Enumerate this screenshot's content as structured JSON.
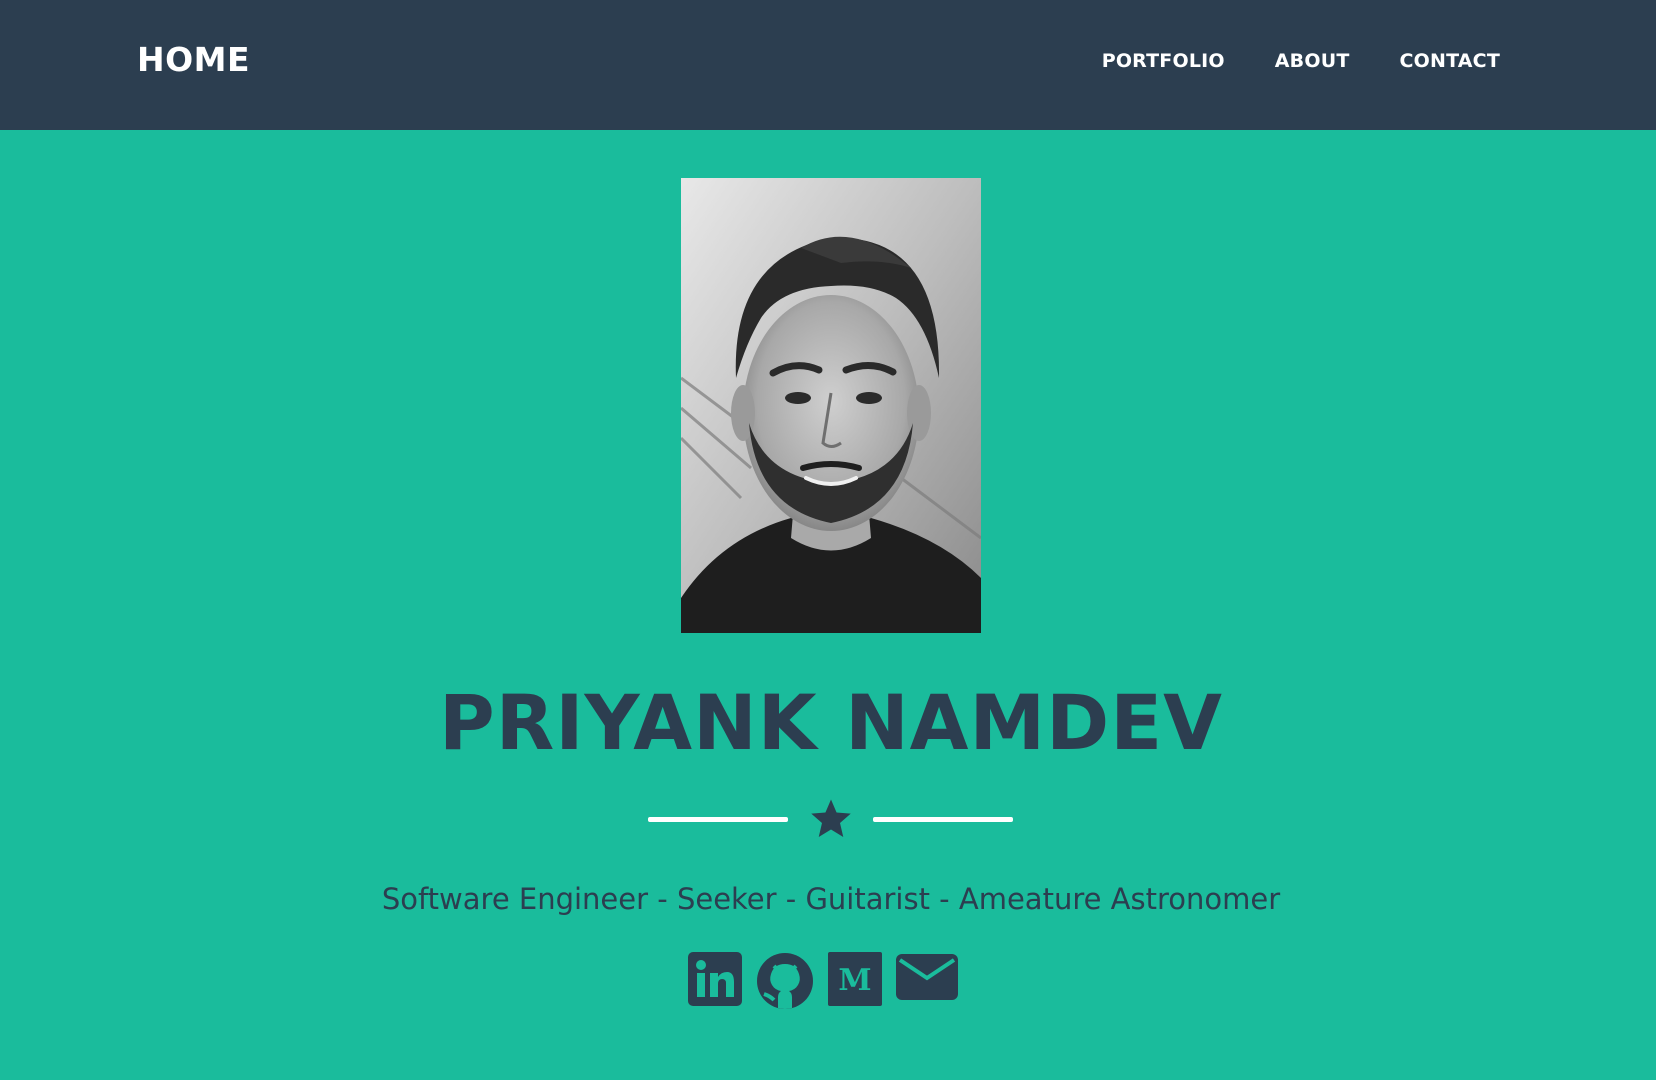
{
  "navbar": {
    "brand": "HOME",
    "links": [
      {
        "label": "PORTFOLIO"
      },
      {
        "label": "ABOUT"
      },
      {
        "label": "CONTACT"
      }
    ]
  },
  "masthead": {
    "portrait_alt": "",
    "name": "PRIYANK NAMDEV",
    "tagline": "Software Engineer - Seeker - Guitarist - Ameature Astronomer",
    "divider_icon": "star-icon",
    "socials": [
      {
        "icon": "linkedin-icon"
      },
      {
        "icon": "github-icon"
      },
      {
        "icon": "medium-icon"
      },
      {
        "icon": "envelope-icon"
      }
    ]
  },
  "colors": {
    "navbar_bg": "#2c3e50",
    "masthead_bg": "#1abc9c",
    "primary_text": "#2c3e50",
    "light_text": "#ffffff"
  }
}
